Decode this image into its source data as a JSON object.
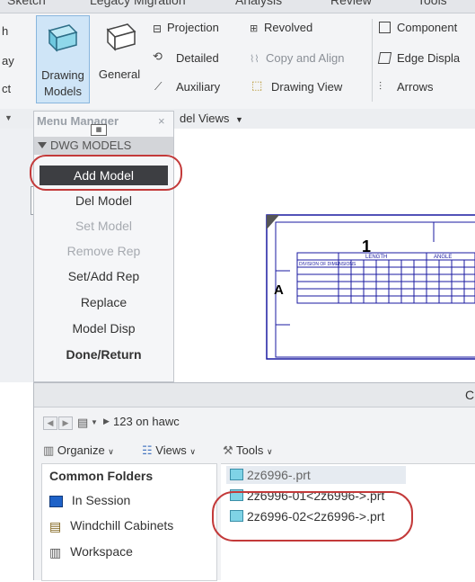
{
  "ribbon": {
    "top_tabs": [
      "Sketch",
      "Legacy Migration",
      "Analysis",
      "Review",
      "Tools"
    ],
    "left_cut": [
      "h",
      "ay",
      "ct"
    ],
    "drawing_models_line1": "Drawing",
    "drawing_models_line2": "Models",
    "general": "General",
    "projection": "Projection",
    "revolved": "Revolved",
    "detailed": "Detailed",
    "copy_align": "Copy and Align",
    "auxiliary": "Auxiliary",
    "drawing_view": "Drawing View",
    "component": "Component",
    "edge_display": "Edge Displa",
    "arrows": "Arrows",
    "model_views": "del Views"
  },
  "menu": {
    "title": "Menu Manager",
    "close": "×",
    "section": "DWG MODELS",
    "items": [
      "Add Model",
      "Del Model",
      "Set Model",
      "Remove Rep",
      "Set/Add Rep",
      "Replace",
      "Model Disp",
      "Done/Return"
    ]
  },
  "drawing": {
    "col_label": "1",
    "row_label": "A",
    "table_header": "DIVISION OF DIMENSIONS",
    "length_label": "LENGTH",
    "angle_label": "ANGLE"
  },
  "browser": {
    "title_char": "C",
    "path": "123 on hawc",
    "organize": "Organize",
    "views": "Views",
    "tools": "Tools",
    "folders_header": "Common Folders",
    "folders": [
      "In Session",
      "Windchill Cabinets",
      "Workspace"
    ],
    "files": [
      "2z6996-.prt",
      "2z6996-01<2z6996->.prt",
      "2z6996-02<2z6996->.prt"
    ]
  }
}
